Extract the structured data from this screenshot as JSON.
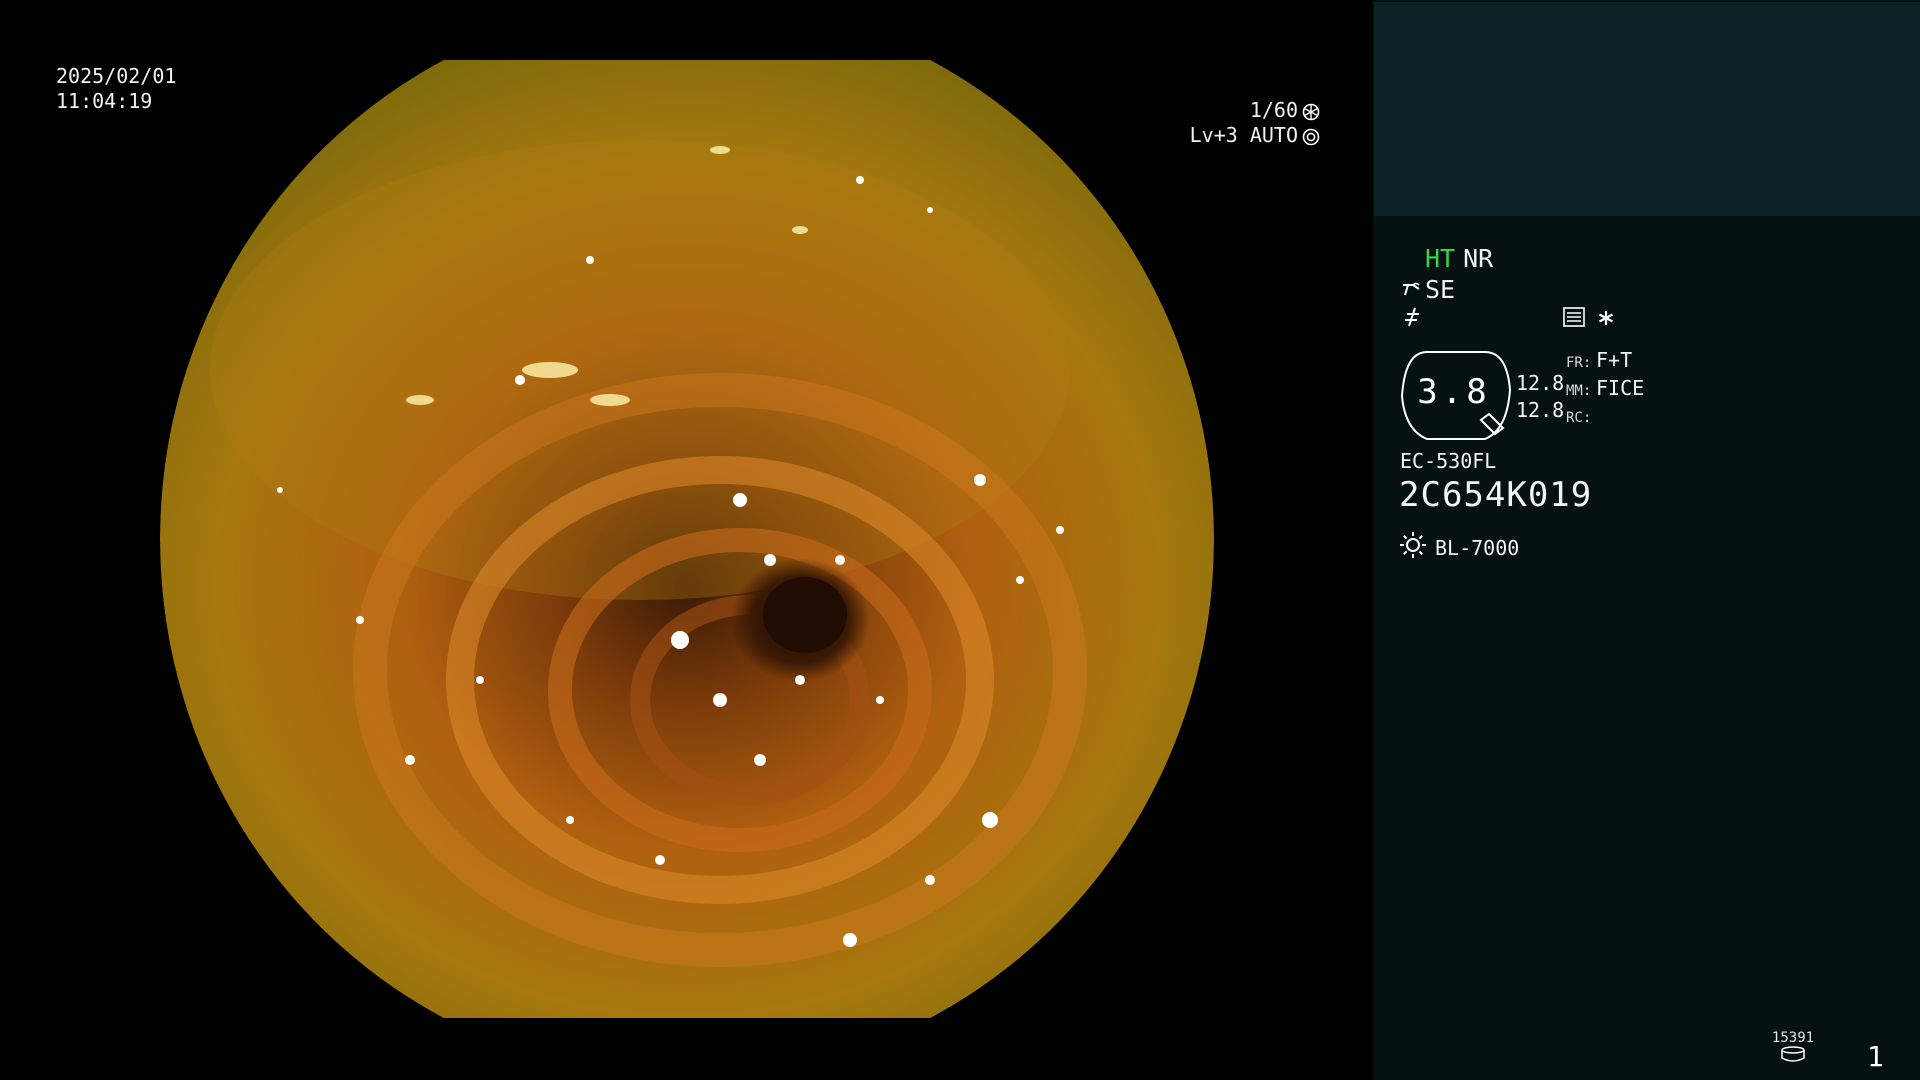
{
  "overlay": {
    "date": "2025/02/01",
    "time": "11:04:19",
    "shutter_speed": "1/60",
    "exposure": "Lv+3 AUTO"
  },
  "panel": {
    "ht_label": "HT",
    "nr_label": "NR",
    "se_label": "SE",
    "zoom_value": "3.8",
    "zoom_left_values": [
      "12.8",
      "12.8"
    ],
    "fr_label": "FR:",
    "fr_value": "F+T",
    "mm_label": "MM:",
    "mm_value": "FICE",
    "rc_label": "RC:",
    "scope_model": "EC-530FL",
    "scope_serial": "2C654K019",
    "light_source": "BL-7000",
    "counter": "15391",
    "page_number": "1"
  },
  "colors": {
    "background": "#000000",
    "panel_bg": "#061212",
    "thumb_bg": "#0b2326",
    "ht_green": "#39d34a"
  },
  "icons": {
    "shutter": "aperture-icon",
    "auto": "iris-icon",
    "scope_mode": "scope-tip-icon",
    "freeze": "freeze-slash-icon",
    "settings": "menu-list-icon",
    "star": "asterisk-icon",
    "light": "sun-icon",
    "storage": "disk-icon"
  }
}
